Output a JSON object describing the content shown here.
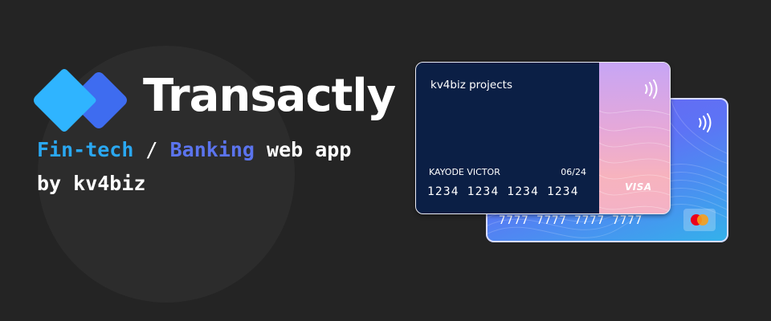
{
  "brand": {
    "name": "Transactly",
    "colors": {
      "light": "#2fb4ff",
      "dark": "#3e6cf0",
      "background": "#242424"
    }
  },
  "tagline": {
    "word1": "Fin-tech",
    "separator": "/",
    "word2": "Banking",
    "rest": "web app"
  },
  "byline": "by kv4biz",
  "card_front": {
    "org": "kv4biz projects",
    "holder": "KAYODE VICTOR",
    "expiry": "06/24",
    "number": "1234 1234 1234 1234",
    "network": "VISA",
    "icons": [
      "contactless-icon",
      "visa-logo"
    ]
  },
  "card_back": {
    "number": "7777 7777 7777 7777",
    "icons": [
      "contactless-icon",
      "mastercard-logo"
    ]
  }
}
